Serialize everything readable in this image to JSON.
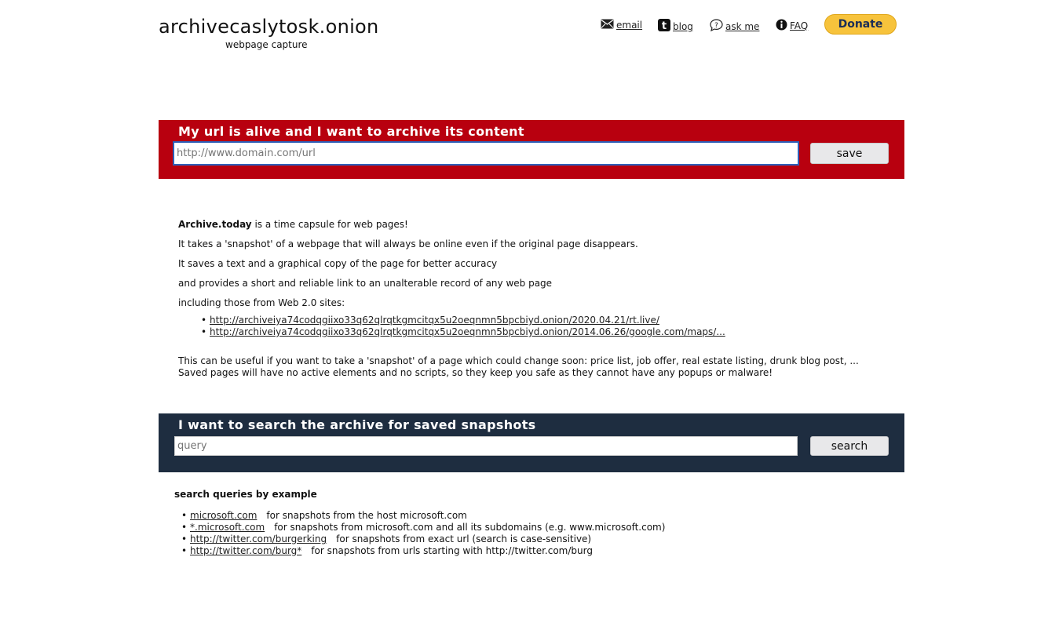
{
  "header": {
    "title": "archivecaslytosk.onion",
    "subtitle": "webpage capture"
  },
  "nav": {
    "email": "email",
    "blog": "blog",
    "ask_me": "ask me",
    "faq": "FAQ",
    "donate": "Donate"
  },
  "save_panel": {
    "title": "My url is alive and I want to archive its content",
    "placeholder": "http://www.domain.com/url",
    "button": "save",
    "color": "#b8000f"
  },
  "intro": {
    "brand": "Archive.today",
    "line1_rest": " is a time capsule for web pages!",
    "line2": "It takes a 'snapshot' of a webpage that will always be online even if the original page disappears.",
    "line3": "It saves a text and a graphical copy of the page for better accuracy",
    "line4": "and provides a short and reliable link to an unalterable record of any web page",
    "line5": "including those from Web 2.0 sites:",
    "examples": [
      "http://archiveiya74codqgiixo33q62qlrqtkgmcitqx5u2oeqnmn5bpcbiyd.onion/2020.04.21/rt.live/",
      "http://archiveiya74codqgiixo33q62qlrqtkgmcitqx5u2oeqnmn5bpcbiyd.onion/2014.06.26/google.com/maps/..."
    ],
    "useful1": "This can be useful if you want to take a 'snapshot' of a page which could change soon: price list, job offer, real estate listing, drunk blog post, ...",
    "useful2": "Saved pages will have no active elements and no scripts, so they keep you safe as they cannot have any popups or malware!"
  },
  "search_panel": {
    "title": "I want to search the archive for saved snapshots",
    "placeholder": "query",
    "button": "search",
    "color": "#1e2d40"
  },
  "search_examples": {
    "heading": "search queries by example",
    "items": [
      {
        "query": "microsoft.com",
        "desc": "for snapshots from the host microsoft.com"
      },
      {
        "query": "*.microsoft.com",
        "desc": "for snapshots from microsoft.com and all its subdomains (e.g. www.microsoft.com)"
      },
      {
        "query": "http://twitter.com/burgerking",
        "desc": "for snapshots from exact url (search is case-sensitive)"
      },
      {
        "query": "http://twitter.com/burg*",
        "desc": "for snapshots from urls starting with http://twitter.com/burg"
      }
    ]
  },
  "icons": {
    "email": "envelope-icon",
    "blog": "tumblr-icon",
    "ask_me": "question-bubble-icon",
    "faq": "info-icon"
  },
  "colors": {
    "donate_bg": "#f7c33c",
    "donate_text": "#1a2d57"
  }
}
